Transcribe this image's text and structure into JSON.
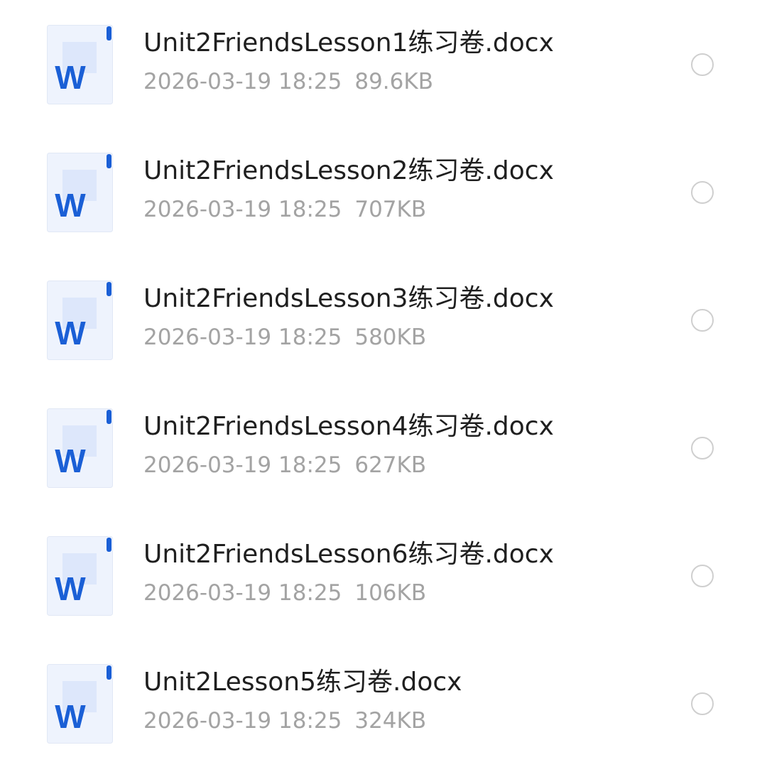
{
  "colors": {
    "doc_blue": "#1a5fd6",
    "icon_bg": "#eef3fd",
    "name_text": "#1f1f1f",
    "meta_text": "#a3a3a3",
    "radio_border": "#cfcfcf"
  },
  "files": [
    {
      "name": "Unit2FriendsLesson1练习卷.docx",
      "date": "2026-03-19 18:25",
      "size": "89.6KB",
      "icon": "word-doc-icon",
      "icon_letter": "W"
    },
    {
      "name": "Unit2FriendsLesson2练习卷.docx",
      "date": "2026-03-19 18:25",
      "size": "707KB",
      "icon": "word-doc-icon",
      "icon_letter": "W"
    },
    {
      "name": "Unit2FriendsLesson3练习卷.docx",
      "date": "2026-03-19 18:25",
      "size": "580KB",
      "icon": "word-doc-icon",
      "icon_letter": "W"
    },
    {
      "name": "Unit2FriendsLesson4练习卷.docx",
      "date": "2026-03-19 18:25",
      "size": "627KB",
      "icon": "word-doc-icon",
      "icon_letter": "W"
    },
    {
      "name": "Unit2FriendsLesson6练习卷.docx",
      "date": "2026-03-19 18:25",
      "size": "106KB",
      "icon": "word-doc-icon",
      "icon_letter": "W"
    },
    {
      "name": "Unit2Lesson5练习卷.docx",
      "date": "2026-03-19 18:25",
      "size": "324KB",
      "icon": "word-doc-icon",
      "icon_letter": "W"
    }
  ]
}
